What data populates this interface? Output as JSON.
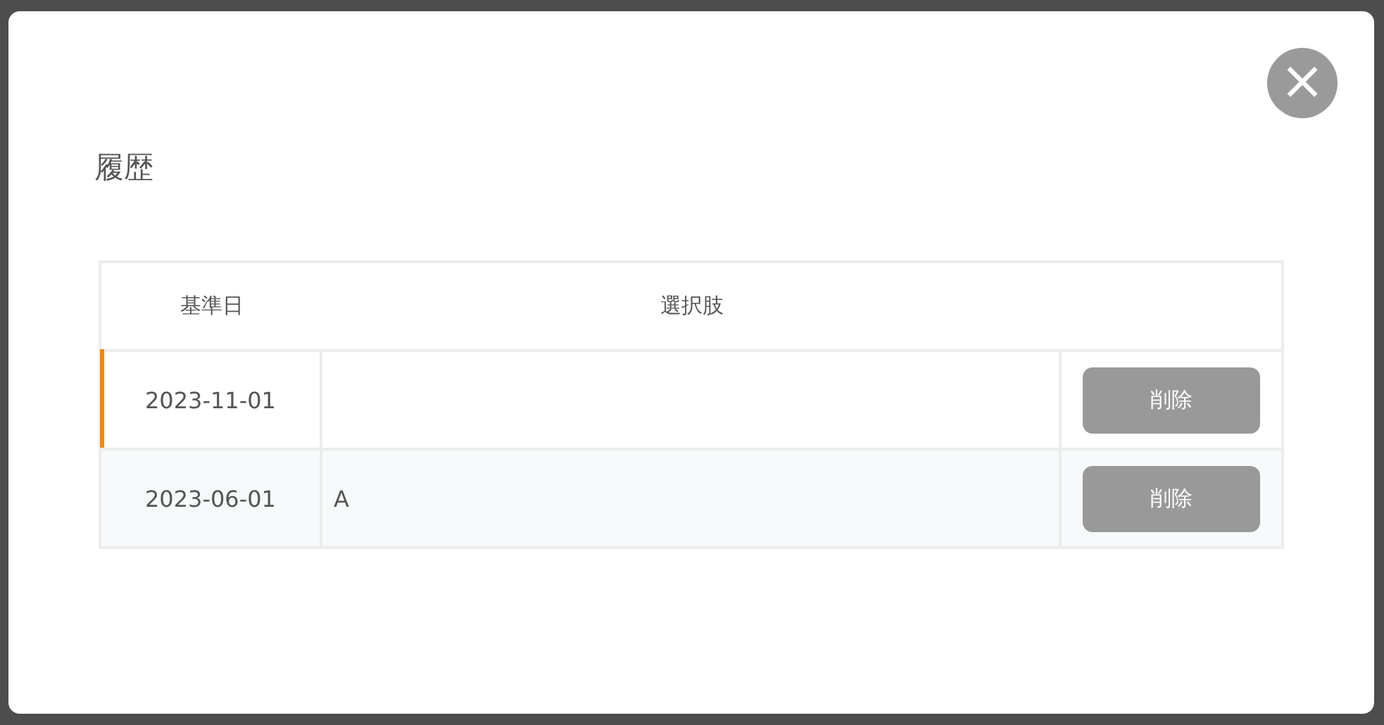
{
  "dialog": {
    "title": "履歴",
    "close_label": "×"
  },
  "table": {
    "columns": [
      "基準日",
      "選択肢"
    ],
    "rows": [
      {
        "date": "2023-11-01",
        "choice": "",
        "button": "削除",
        "selected": true
      },
      {
        "date": "2023-06-01",
        "choice": "A",
        "button": "削除",
        "selected": false
      }
    ]
  }
}
